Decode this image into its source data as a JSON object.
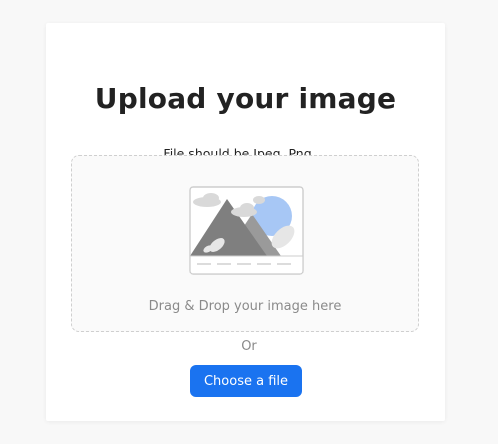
{
  "header": {
    "title": "Upload your image",
    "subtitle": "File should be Jpeg, Png,..."
  },
  "dropzone": {
    "text": "Drag & Drop your image here",
    "icon": "image-placeholder-icon"
  },
  "divider": {
    "or_text": "Or"
  },
  "actions": {
    "choose_label": "Choose a file"
  },
  "colors": {
    "accent": "#1a73f0",
    "sun": "#a7c7f5",
    "mountain": "#8a8a8a",
    "cloud": "#d9d9d9"
  }
}
